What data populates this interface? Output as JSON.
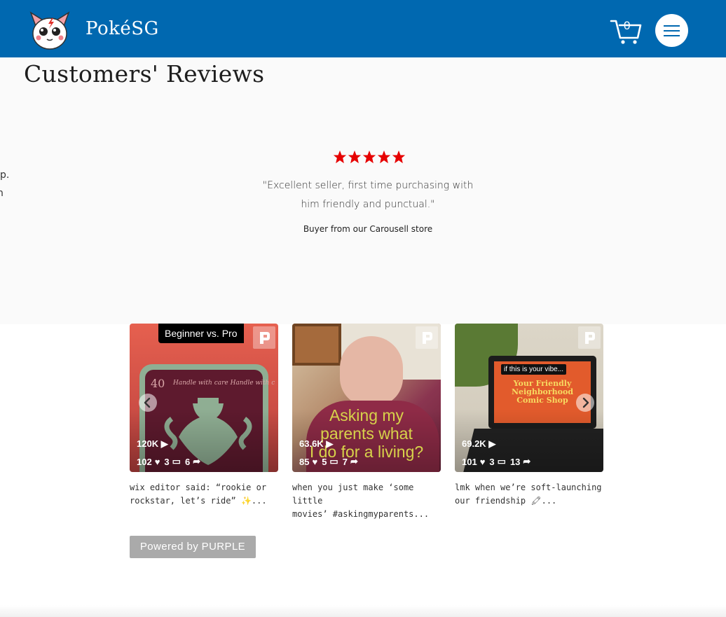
{
  "header": {
    "brand": "PokéSG",
    "cart_count": "0",
    "logo": "pokemon-mascot-logo",
    "colors": {
      "background": "#0068b0",
      "text": "#ffffff"
    }
  },
  "reviews": {
    "title": "Customers' Reviews",
    "rating": 5,
    "quote_line1": "\"Excellent seller, first time purchasing with",
    "quote_line2": "him friendly and punctual.\"",
    "author": "Buyer from our Carousell store",
    "peek_text_1": "p.",
    "peek_text_2": "n",
    "colors": {
      "star": "#e60000",
      "background": "#fafafa"
    }
  },
  "feed": {
    "cards": [
      {
        "badge": "Beginner vs. Pro",
        "views": "120K",
        "likes": "102",
        "comments": "3",
        "shares": "6",
        "caption_line1": "wix editor said: “rookie or",
        "caption_line2": "rockstar, let’s ride” ✨..."
      },
      {
        "overlay_line1": "Asking my",
        "overlay_line2": "parents what",
        "overlay_line3": "I do for a living?",
        "views": "63.6K",
        "likes": "85",
        "comments": "5",
        "shares": "7",
        "caption_line1": "when you just make ‘some little",
        "caption_line2": "movies’ #askingmyparents..."
      },
      {
        "screen_tag": "if this is your vibe...",
        "screen_title_1": "Your Friendly",
        "screen_title_2": "Neighborhood",
        "screen_title_3": "Comic Shop",
        "views": "69.2K",
        "likes": "101",
        "comments": "3",
        "shares": "13",
        "caption_line1": "lmk when we’re soft-launching",
        "caption_line2": "our friendship 🖍..."
      }
    ],
    "powered_by": "Powered by PURPLE"
  }
}
